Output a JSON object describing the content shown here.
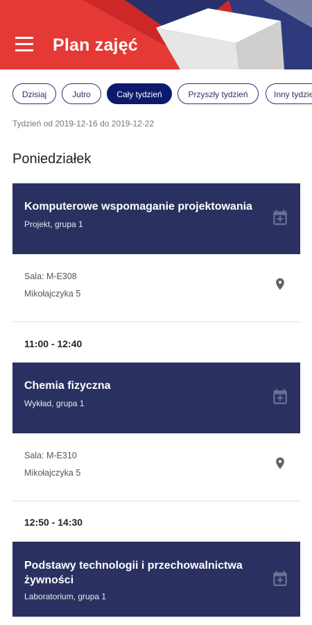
{
  "app": {
    "title": "Plan zajęć",
    "menu_icon": "menu-icon"
  },
  "colors": {
    "header_red": "#e53935",
    "navy": "#2a3160",
    "chip_active": "#0c1b6e"
  },
  "filters": [
    {
      "label": "Dzisiaj",
      "active": false
    },
    {
      "label": "Jutro",
      "active": false
    },
    {
      "label": "Cały tydzień",
      "active": true
    },
    {
      "label": "Przyszły tydzień",
      "active": false
    },
    {
      "label": "Inny tydzień",
      "active": false
    }
  ],
  "week_range": "Tydzień od 2019-12-16 do 2019-12-22",
  "day": {
    "name": "Poniedziałek"
  },
  "classes": [
    {
      "title": "Komputerowe wspomaganie projektowania",
      "subtitle": "Projekt, grupa 1",
      "room": "Sala: M-E308",
      "address": "Mikołajczyka 5"
    },
    {
      "time": "11:00 - 12:40",
      "title": "Chemia fizyczna",
      "subtitle": "Wykład, grupa 1",
      "room": "Sala: M-E310",
      "address": "Mikołajczyka 5"
    },
    {
      "time": "12:50 - 14:30",
      "title": "Podstawy technologii i przechowalnictwa żywności",
      "subtitle": "Laboratorium, grupa 1"
    }
  ]
}
